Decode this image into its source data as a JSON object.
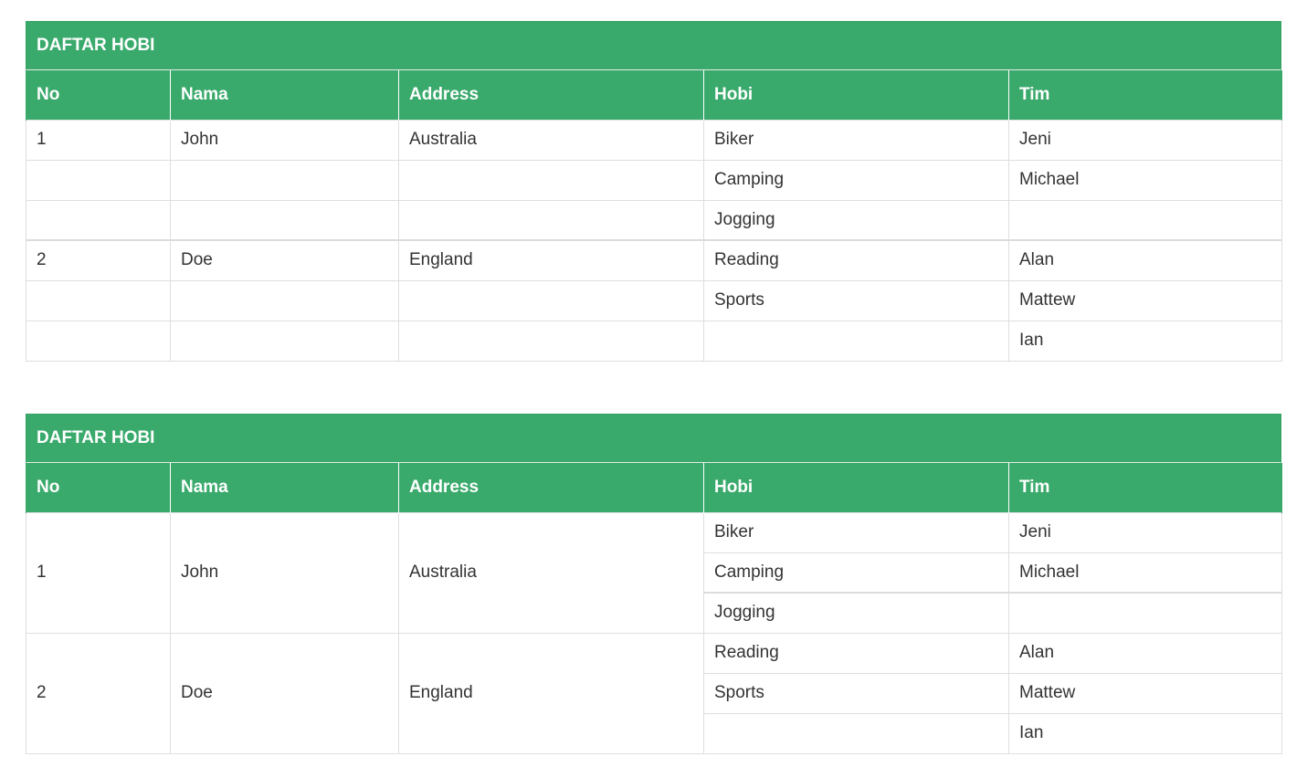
{
  "tables": [
    {
      "title": "DAFTAR HOBI",
      "headers": [
        "No",
        "Nama",
        "Address",
        "Hobi",
        "Tim"
      ],
      "rows": [
        [
          "1",
          "John",
          "Australia",
          "Biker",
          "Jeni"
        ],
        [
          "",
          "",
          "",
          "Camping",
          "Michael"
        ],
        [
          "",
          "",
          "",
          "Jogging",
          ""
        ],
        [
          "2",
          "Doe",
          "England",
          "Reading",
          "Alan"
        ],
        [
          "",
          "",
          "",
          "Sports",
          "Mattew"
        ],
        [
          "",
          "",
          "",
          "",
          "Ian"
        ]
      ]
    },
    {
      "title": "DAFTAR HOBI",
      "headers": [
        "No",
        "Nama",
        "Address",
        "Hobi",
        "Tim"
      ],
      "groups": [
        {
          "no": "1",
          "nama": "John",
          "address": "Australia",
          "hobi": [
            "Biker",
            "Camping",
            "Jogging"
          ],
          "tim": [
            "Jeni",
            "Michael",
            ""
          ]
        },
        {
          "no": "2",
          "nama": "Doe",
          "address": "England",
          "hobi": [
            "Reading",
            "Sports",
            ""
          ],
          "tim": [
            "Alan",
            "Mattew",
            "Ian"
          ]
        }
      ]
    }
  ],
  "colors": {
    "header_bg": "#3aaa6c",
    "header_text": "#ffffff",
    "border": "#dedede",
    "text": "#333333"
  }
}
